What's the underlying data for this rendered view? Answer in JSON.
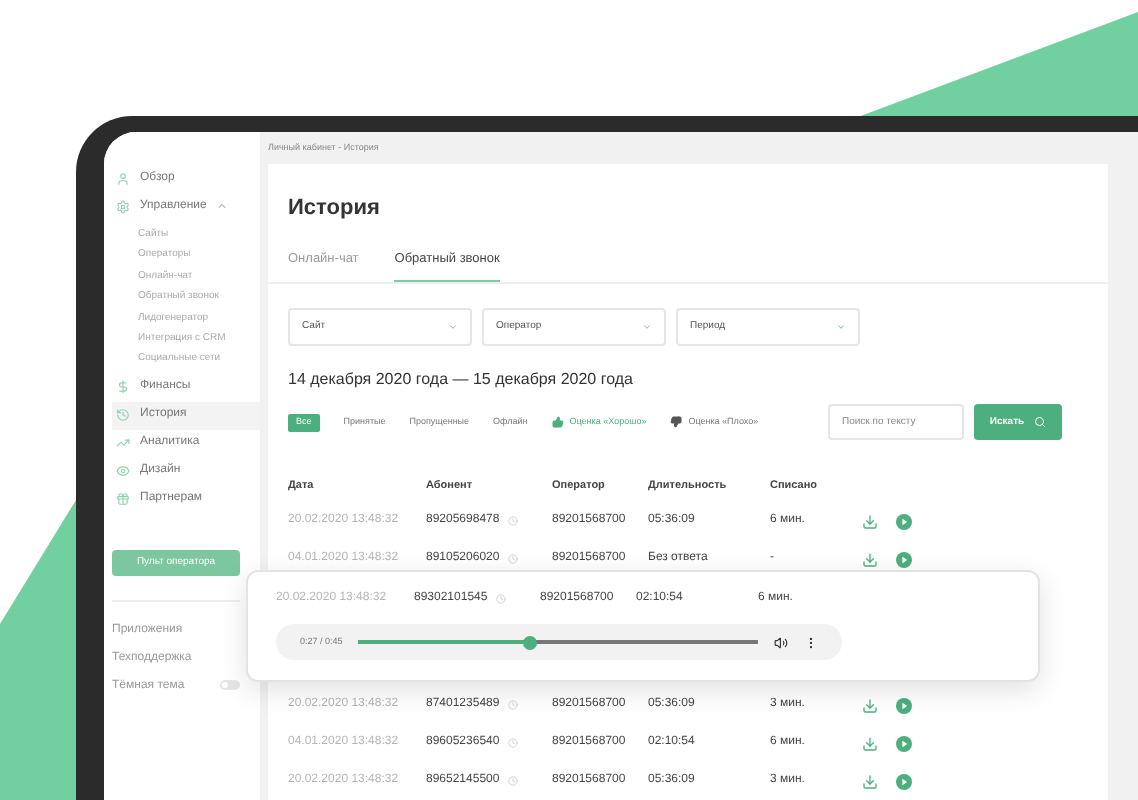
{
  "breadcrumb": "Личный кабинет - История",
  "sidebar": {
    "items": [
      {
        "label": "Обзор",
        "selected": false
      },
      {
        "label": "Управление",
        "selected": false,
        "expanded": true,
        "children": [
          {
            "label": "Сайты"
          },
          {
            "label": "Операторы"
          },
          {
            "label": "Онлайн-чат"
          },
          {
            "label": "Обратный звонок"
          },
          {
            "label": "Лидогенератор"
          },
          {
            "label": "Интеграция с CRM"
          },
          {
            "label": "Социальные сети"
          }
        ]
      },
      {
        "label": "Финансы",
        "selected": false
      },
      {
        "label": "История",
        "selected": true
      },
      {
        "label": "Аналитика",
        "selected": false
      },
      {
        "label": "Дизайн",
        "selected": false
      },
      {
        "label": "Партнерам",
        "selected": false
      }
    ],
    "operator_button": "Пульт оператора",
    "footer_links": [
      "Приложения",
      "Техподдержка"
    ],
    "dark_theme": {
      "label": "Тёмная тема",
      "on": false
    }
  },
  "page_title": "История",
  "tabs": [
    {
      "label": "Онлайн-чат",
      "selected": false
    },
    {
      "label": "Обратный звонок",
      "selected": true
    }
  ],
  "filters": [
    {
      "label": "Сайт"
    },
    {
      "label": "Оператор"
    },
    {
      "label": "Период"
    }
  ],
  "date_range": "14 декабря 2020 года — 15 декабря 2020 года",
  "status_filters": [
    {
      "label": "Все",
      "selected": true,
      "kind": "plain"
    },
    {
      "label": "Принятые",
      "selected": false,
      "kind": "plain"
    },
    {
      "label": "Пропущенные",
      "selected": false,
      "kind": "plain"
    },
    {
      "label": "Офлайн",
      "selected": false,
      "kind": "plain"
    },
    {
      "label": "Оценка «Хорошо»",
      "selected": false,
      "kind": "good"
    },
    {
      "label": "Оценка «Плохо»",
      "selected": false,
      "kind": "bad"
    }
  ],
  "search": {
    "placeholder": "Поиск по тексту",
    "button": "Искать"
  },
  "table": {
    "columns": [
      "Дата",
      "Абонент",
      "Оператор",
      "Длительность",
      "Списано"
    ],
    "rows": [
      {
        "date": "20.02.2020  13:48:32",
        "subscriber": "89205698478",
        "operator": "89201568700",
        "duration": "05:36:09",
        "charged": "6 мин."
      },
      {
        "date": "04.01.2020  13:48:32",
        "subscriber": "89105206020",
        "operator": "89201568700",
        "duration": "Без ответа",
        "charged": "-"
      },
      {
        "date": "20.02.2020  13:48:32",
        "subscriber": "87401235489",
        "operator": "89201568700",
        "duration": "05:36:09",
        "charged": "3 мин."
      },
      {
        "date": "04.01.2020  13:48:32",
        "subscriber": "89605236540",
        "operator": "89201568700",
        "duration": "02:10:54",
        "charged": "6 мин."
      },
      {
        "date": "20.02.2020  13:48:32",
        "subscriber": "89652145500",
        "operator": "89201568700",
        "duration": "05:36:09",
        "charged": "3 мин."
      }
    ]
  },
  "player_popup": {
    "date": "20.02.2020  13:48:32",
    "subscriber": "89302101545",
    "operator": "89201568700",
    "duration": "02:10:54",
    "charged": "6 мин.",
    "time": "0:27 / 0:45",
    "level": 0.43
  }
}
